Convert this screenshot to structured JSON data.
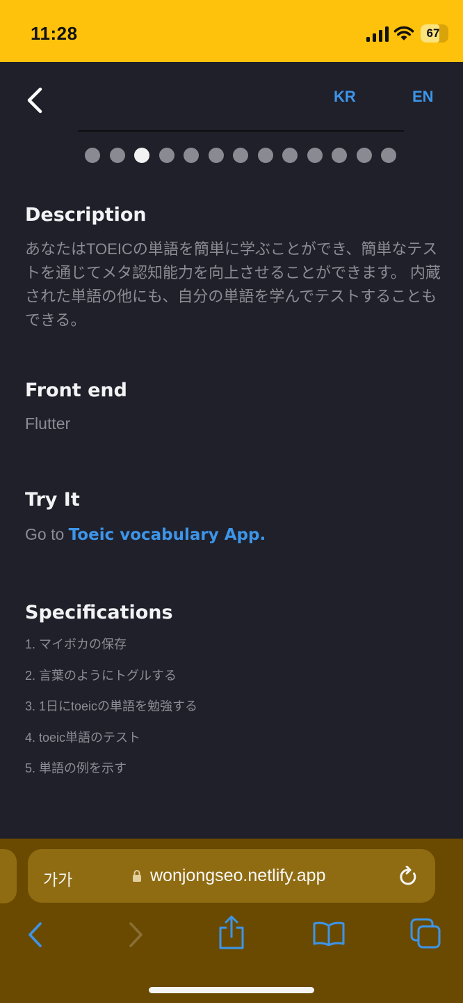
{
  "status_bar": {
    "time": "11:28",
    "battery_level": "67",
    "battery_fraction": 0.67,
    "icons": [
      "cellular-signal-icon",
      "wifi-icon",
      "battery-icon"
    ]
  },
  "header": {
    "back_icon": "chevron-left-icon",
    "lang_kr": "KR",
    "lang_en": "EN"
  },
  "pagination": {
    "total": 13,
    "active_index": 2
  },
  "sections": {
    "description": {
      "title": "Description",
      "text": "あなたはTOEICの単語を簡単に学ぶことができ、簡単なテストを通じてメタ認知能力を向上させることができます。 内蔵された単語の他にも、自分の単語を学んでテストすることもできる。"
    },
    "front_end": {
      "title": "Front end",
      "value": "Flutter"
    },
    "try_it": {
      "title": "Try It",
      "prefix": "Go to",
      "link_text": "Toeic vocabulary App."
    },
    "specifications": {
      "title": "Specifications",
      "items": [
        "1. マイボカの保存",
        "2. 言葉のようにトグルする",
        "3. 1日にtoeicの単語を勉強する",
        "4. toeic単語のテスト",
        "5. 単語の例を示す"
      ]
    }
  },
  "browser": {
    "text_size_label": "가가",
    "url": "wonjongseo.netlify.app",
    "icons": [
      "lock-icon",
      "reload-icon",
      "back-arrow-icon",
      "forward-arrow-icon",
      "share-icon",
      "bookmarks-icon",
      "tabs-icon"
    ]
  },
  "colors": {
    "status_bar_bg": "#fec20c",
    "page_bg": "#20202a",
    "accent_link": "#3d95e9",
    "toolbar_bg": "#6a4a00",
    "url_bar_bg": "#8f6c11"
  }
}
